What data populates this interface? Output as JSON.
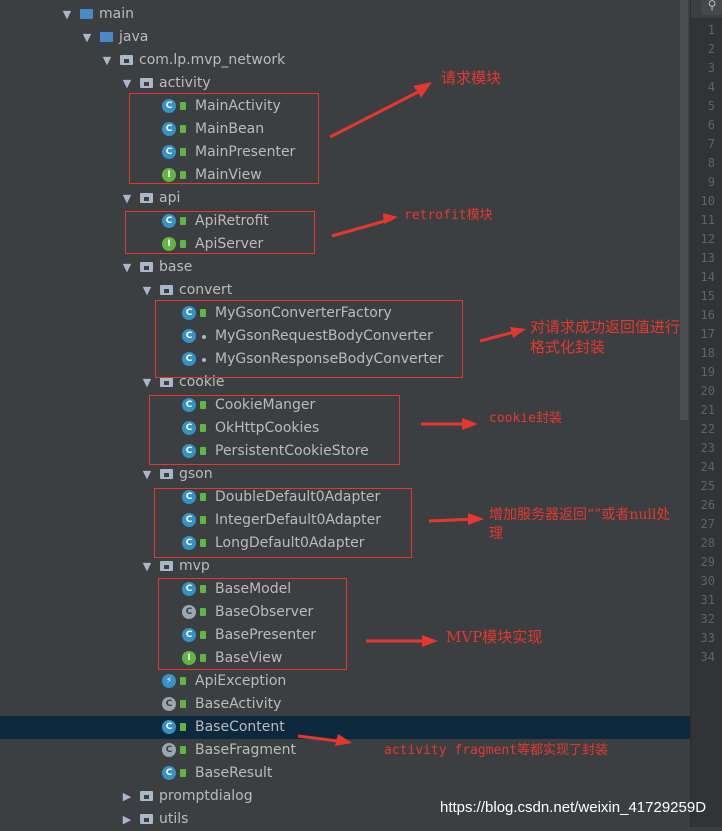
{
  "project_tree": {
    "rows": [
      {
        "label": "main",
        "kind": "folder",
        "folder_color": "blue",
        "arrow": "down",
        "selected": false
      },
      {
        "label": "java",
        "kind": "folder",
        "folder_color": "blue",
        "arrow": "down",
        "selected": false
      },
      {
        "label": "com.lp.mvp_network",
        "kind": "folder",
        "folder_color": "gray",
        "arrow": "down",
        "selected": false
      },
      {
        "label": "activity",
        "kind": "folder",
        "folder_color": "gray",
        "arrow": "down",
        "selected": false
      },
      {
        "label": "MainActivity",
        "kind": "class",
        "icon_letter": "C",
        "selected": false
      },
      {
        "label": "MainBean",
        "kind": "class",
        "icon_letter": "C",
        "selected": false
      },
      {
        "label": "MainPresenter",
        "kind": "class",
        "icon_letter": "C",
        "selected": false
      },
      {
        "label": "MainView",
        "kind": "interface",
        "icon_letter": "I",
        "selected": false
      },
      {
        "label": "api",
        "kind": "folder",
        "folder_color": "gray",
        "arrow": "down",
        "selected": false
      },
      {
        "label": "ApiRetrofit",
        "kind": "class",
        "icon_letter": "C",
        "selected": false
      },
      {
        "label": "ApiServer",
        "kind": "interface",
        "icon_letter": "I",
        "selected": false
      },
      {
        "label": "base",
        "kind": "folder",
        "folder_color": "gray",
        "arrow": "down",
        "selected": false
      },
      {
        "label": "convert",
        "kind": "folder",
        "folder_color": "gray",
        "arrow": "down",
        "selected": false
      },
      {
        "label": "MyGsonConverterFactory",
        "kind": "class",
        "icon_letter": "C",
        "selected": false
      },
      {
        "label": "MyGsonRequestBodyConverter",
        "kind": "class-dot",
        "icon_letter": "C",
        "selected": false
      },
      {
        "label": "MyGsonResponseBodyConverter",
        "kind": "class-dot",
        "icon_letter": "C",
        "selected": false
      },
      {
        "label": "cookie",
        "kind": "folder",
        "folder_color": "gray",
        "arrow": "down",
        "selected": false
      },
      {
        "label": "CookieManger",
        "kind": "class",
        "icon_letter": "C",
        "selected": false
      },
      {
        "label": "OkHttpCookies",
        "kind": "class",
        "icon_letter": "C",
        "selected": false
      },
      {
        "label": "PersistentCookieStore",
        "kind": "class",
        "icon_letter": "C",
        "selected": false
      },
      {
        "label": "gson",
        "kind": "folder",
        "folder_color": "gray",
        "arrow": "down",
        "selected": false
      },
      {
        "label": "DoubleDefault0Adapter",
        "kind": "class",
        "icon_letter": "C",
        "selected": false
      },
      {
        "label": "IntegerDefault0Adapter",
        "kind": "class",
        "icon_letter": "C",
        "selected": false
      },
      {
        "label": "LongDefault0Adapter",
        "kind": "class",
        "icon_letter": "C",
        "selected": false
      },
      {
        "label": "mvp",
        "kind": "folder",
        "folder_color": "gray",
        "arrow": "down",
        "selected": false
      },
      {
        "label": "BaseModel",
        "kind": "class",
        "icon_letter": "C",
        "selected": false
      },
      {
        "label": "BaseObserver",
        "kind": "abstract",
        "icon_letter": "C",
        "selected": false
      },
      {
        "label": "BasePresenter",
        "kind": "class",
        "icon_letter": "C",
        "selected": false
      },
      {
        "label": "BaseView",
        "kind": "interface",
        "icon_letter": "I",
        "selected": false
      },
      {
        "label": "ApiException",
        "kind": "exception",
        "icon_letter": "⚡",
        "selected": false
      },
      {
        "label": "BaseActivity",
        "kind": "abstract",
        "icon_letter": "C",
        "selected": false
      },
      {
        "label": "BaseContent",
        "kind": "class",
        "icon_letter": "C",
        "selected": true
      },
      {
        "label": "BaseFragment",
        "kind": "abstract",
        "icon_letter": "C",
        "selected": false
      },
      {
        "label": "BaseResult",
        "kind": "class",
        "icon_letter": "C",
        "selected": false
      },
      {
        "label": "promptdialog",
        "kind": "folder",
        "folder_color": "gray",
        "arrow": "right",
        "selected": false
      },
      {
        "label": "utils",
        "kind": "folder",
        "folder_color": "gray",
        "arrow": "right",
        "selected": false
      }
    ]
  },
  "editor_gutter": {
    "line_numbers": [
      "1",
      "2",
      "3",
      "4",
      "5",
      "6",
      "7",
      "8",
      "9",
      "10",
      "11",
      "12",
      "13",
      "14",
      "15",
      "16",
      "17",
      "18",
      "19",
      "20",
      "21",
      "22",
      "23",
      "24",
      "25",
      "26",
      "27",
      "28",
      "29",
      "30",
      "31",
      "32",
      "33",
      "34"
    ],
    "search_icon": "search-icon"
  },
  "annotations": [
    {
      "text": "请求模块"
    },
    {
      "text": "retrofit模块"
    },
    {
      "text_line1": "对请求成功返回值进行",
      "text_line2": "格式化封装"
    },
    {
      "text": "cookie封装"
    },
    {
      "text_line1": "增加服务器返回“”或者null处",
      "text_line2": "理"
    },
    {
      "text": "MVP模块实现"
    },
    {
      "text": "activity fragment等都实现了封装"
    }
  ],
  "watermark": "https://blog.csdn.net/weixin_41729259",
  "watermark_tail": "D",
  "colors": {
    "annotation_red": "#e4382f",
    "selection": "#0d293e",
    "panel_bg": "#3c3f41"
  }
}
